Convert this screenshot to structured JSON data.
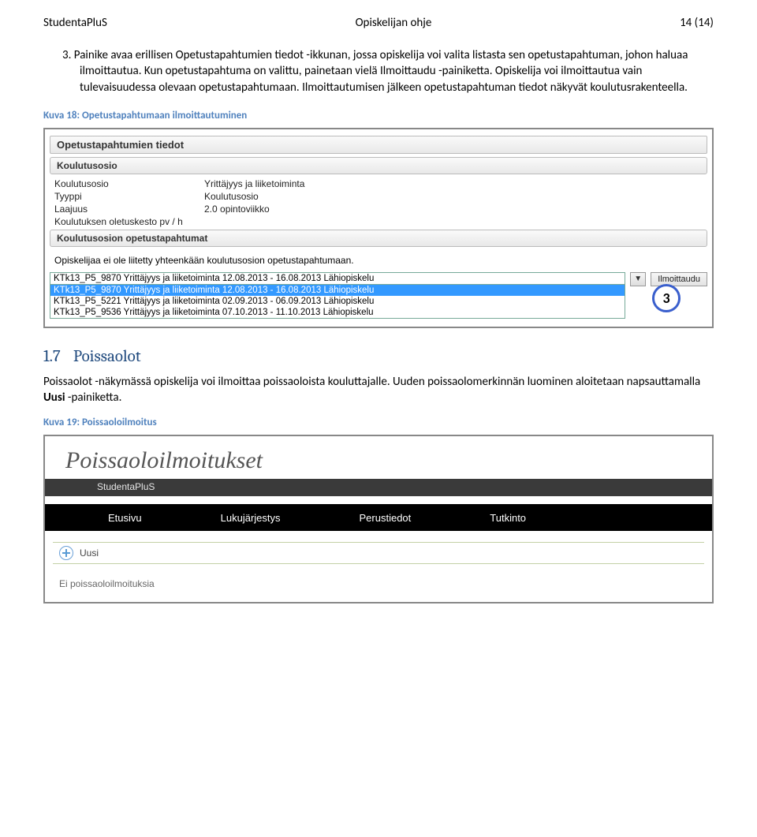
{
  "header": {
    "left": "StudentaPluS",
    "center": "Opiskelijan ohje",
    "right": "14 (14)"
  },
  "num_item": {
    "num": "3.",
    "text": "Painike avaa erillisen Opetustapahtumien tiedot -ikkunan, jossa opiskelija voi valita listasta sen opetustapahtuman, johon haluaa ilmoittautua. Kun opetustapahtuma on valittu, painetaan vielä Ilmoittaudu -painiketta. Opiskelija voi ilmoittautua vain tulevaisuudessa olevaan opetustapahtumaan. Ilmoittautumisen jälkeen opetustapahtuman tiedot näkyvät koulutusrakenteella."
  },
  "caption1": "Kuva 18: Opetustapahtumaan ilmoittautuminen",
  "panel1": {
    "title": "Opetustapahtumien tiedot",
    "sect_a": "Koulutusosio",
    "fields": {
      "k1": "Koulutusosio",
      "v1": "Yrittäjyys ja liiketoiminta",
      "k2": "Tyyppi",
      "v2": "Koulutusosio",
      "k3": "Laajuus",
      "v3": "2.0 opintoviikko",
      "k4": "Koulutuksen oletuskesto pv / h",
      "v4": ""
    },
    "sect_b": "Koulutusosion opetustapahtumat",
    "notice": "Opiskelijaa ei ole liitetty yhteenkään koulutusosion opetustapahtumaan.",
    "sel_current": "KTk13_P5_9870 Yrittäjyys ja liiketoiminta 12.08.2013 - 16.08.2013 Lähiopiskelu",
    "options": [
      "KTk13_P5_9870 Yrittäjyys ja liiketoiminta 12.08.2013 - 16.08.2013 Lähiopiskelu",
      "KTk13_P5_5221 Yrittäjyys ja liiketoiminta 02.09.2013 - 06.09.2013 Lähiopiskelu",
      "KTk13_P5_9536 Yrittäjyys ja liiketoiminta 07.10.2013 - 11.10.2013 Lähiopiskelu"
    ],
    "button": "Ilmoittaudu",
    "badge": "3"
  },
  "h2": {
    "num": "1.7",
    "text": "Poissaolot"
  },
  "para": {
    "p1": "Poissaolot -näkymässä opiskelija voi ilmoittaa poissaoloista kouluttajalle. Uuden poissaolomerkinnän luominen aloitetaan napsauttamalla ",
    "bold": "Uusi",
    "p2": " -painiketta."
  },
  "caption2": "Kuva 19: Poissaoloilmoitus",
  "panel2": {
    "title": "Poissaoloilmoitukset",
    "sub": "StudentaPluS",
    "nav": [
      "Etusivu",
      "Lukujärjestys",
      "Perustiedot",
      "Tutkinto"
    ],
    "add": "Uusi",
    "empty": "Ei poissaoloilmoituksia"
  }
}
